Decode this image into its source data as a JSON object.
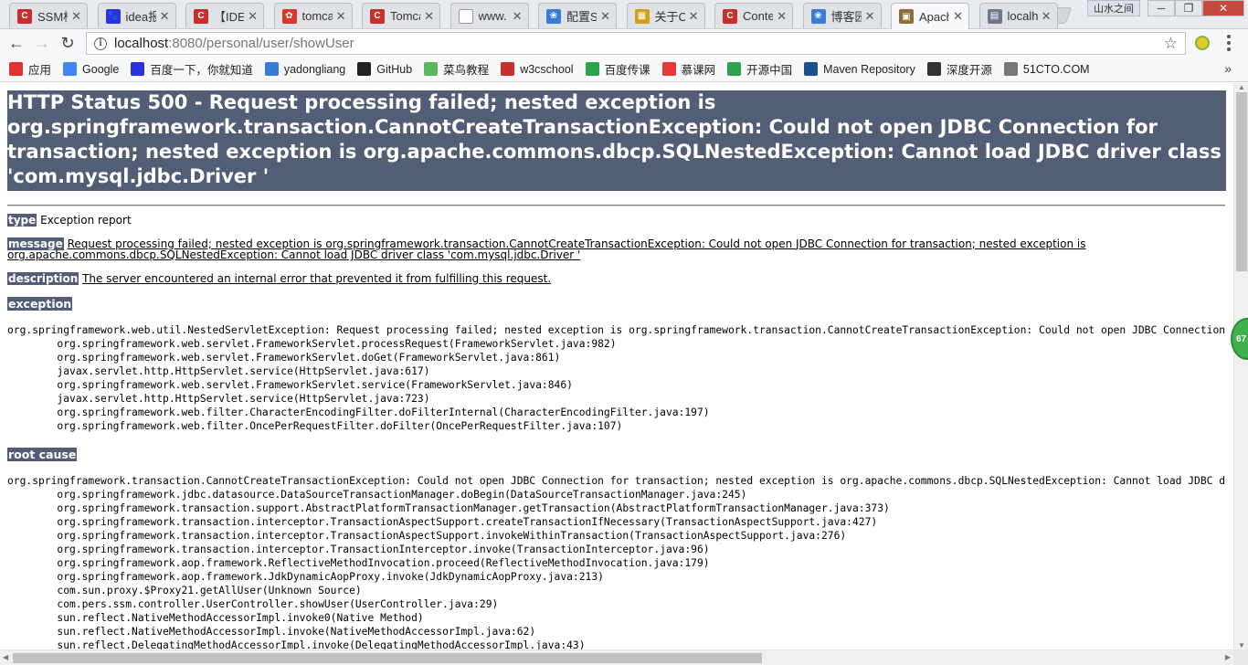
{
  "tabs": [
    {
      "label": "SSM框架",
      "icon": "C",
      "color": "#c7302a"
    },
    {
      "label": "idea报",
      "icon": "🐾",
      "color": "#2932e1"
    },
    {
      "label": "【IDEA",
      "icon": "C",
      "color": "#c7302a"
    },
    {
      "label": "tomcat",
      "icon": "✿",
      "color": "#d9372b"
    },
    {
      "label": "Tomcat",
      "icon": "C",
      "color": "#c7302a"
    },
    {
      "label": "www.",
      "icon": "",
      "color": "#ffffff"
    },
    {
      "label": "配置SSM",
      "icon": "❀",
      "color": "#3a7bd5"
    },
    {
      "label": "关于C",
      "icon": "▦",
      "color": "#d4a017"
    },
    {
      "label": "Contex",
      "icon": "C",
      "color": "#c7302a"
    },
    {
      "label": "博客园",
      "icon": "❀",
      "color": "#3a7bd5"
    },
    {
      "label": "Apache",
      "icon": "▣",
      "color": "#8b6d3a"
    },
    {
      "label": "localh",
      "icon": "▤",
      "color": "#6d7a8a"
    }
  ],
  "window": {
    "user_label": "山水之间",
    "minimize": "─",
    "maximize": "❐",
    "close": "✕"
  },
  "toolbar": {
    "back": "←",
    "forward": "→",
    "reload": "↻",
    "url_host": "localhost",
    "url_rest": ":8080/personal/user/showUser",
    "info": "i",
    "star": "☆"
  },
  "bookmarks": [
    {
      "label": "应用",
      "color": "#d33"
    },
    {
      "label": "Google",
      "color": "#4285f4"
    },
    {
      "label": "百度一下，你就知道",
      "color": "#2932e1"
    },
    {
      "label": "yadongliang",
      "color": "#3a7bd5"
    },
    {
      "label": "GitHub",
      "color": "#222222"
    },
    {
      "label": "菜鸟教程",
      "color": "#5cb85c"
    },
    {
      "label": "w3cschool",
      "color": "#c7302a"
    },
    {
      "label": "百度传课",
      "color": "#2ca24a"
    },
    {
      "label": "慕课网",
      "color": "#e53935"
    },
    {
      "label": "开源中国",
      "color": "#2ca24a"
    },
    {
      "label": "Maven Repository",
      "color": "#1c4f8c"
    },
    {
      "label": "深度开源",
      "color": "#333333"
    },
    {
      "label": "51CTO.COM",
      "color": "#777777"
    }
  ],
  "bookmarks_more": "»",
  "page": {
    "title": "HTTP Status 500 - Request processing failed; nested exception is org.springframework.transaction.CannotCreateTransactionException: Could not open JDBC Connection for transaction; nested exception is org.apache.commons.dbcp.SQLNestedException: Cannot load JDBC driver class 'com.mysql.jdbc.Driver '",
    "type_label": "type",
    "type_value": "Exception report",
    "message_label": "message",
    "message_value": "Request processing failed; nested exception is org.springframework.transaction.CannotCreateTransactionException: Could not open JDBC Connection for transaction; nested exception is org.apache.commons.dbcp.SQLNestedException: Cannot load JDBC driver class 'com.mysql.jdbc.Driver '",
    "description_label": "description",
    "description_value": "The server encountered an internal error that prevented it from fulfilling this request.",
    "exception_label": "exception",
    "exception_trace": "org.springframework.web.util.NestedServletException: Request processing failed; nested exception is org.springframework.transaction.CannotCreateTransactionException: Could not open JDBC Connection for transaction; nested exception is org.apache.commons.dbcp.SQLNestedException: Cannot load JDBC driver class 'com.mysql.jdbc.Driver '\n\torg.springframework.web.servlet.FrameworkServlet.processRequest(FrameworkServlet.java:982)\n\torg.springframework.web.servlet.FrameworkServlet.doGet(FrameworkServlet.java:861)\n\tjavax.servlet.http.HttpServlet.service(HttpServlet.java:617)\n\torg.springframework.web.servlet.FrameworkServlet.service(FrameworkServlet.java:846)\n\tjavax.servlet.http.HttpServlet.service(HttpServlet.java:723)\n\torg.springframework.web.filter.CharacterEncodingFilter.doFilterInternal(CharacterEncodingFilter.java:197)\n\torg.springframework.web.filter.OncePerRequestFilter.doFilter(OncePerRequestFilter.java:107)",
    "root_cause_label": "root cause",
    "root_cause_trace": "org.springframework.transaction.CannotCreateTransactionException: Could not open JDBC Connection for transaction; nested exception is org.apache.commons.dbcp.SQLNestedException: Cannot load JDBC driver class 'com.mysql.jdbc.Driver '\n\torg.springframework.jdbc.datasource.DataSourceTransactionManager.doBegin(DataSourceTransactionManager.java:245)\n\torg.springframework.transaction.support.AbstractPlatformTransactionManager.getTransaction(AbstractPlatformTransactionManager.java:373)\n\torg.springframework.transaction.interceptor.TransactionAspectSupport.createTransactionIfNecessary(TransactionAspectSupport.java:427)\n\torg.springframework.transaction.interceptor.TransactionAspectSupport.invokeWithinTransaction(TransactionAspectSupport.java:276)\n\torg.springframework.transaction.interceptor.TransactionInterceptor.invoke(TransactionInterceptor.java:96)\n\torg.springframework.aop.framework.ReflectiveMethodInvocation.proceed(ReflectiveMethodInvocation.java:179)\n\torg.springframework.aop.framework.JdkDynamicAopProxy.invoke(JdkDynamicAopProxy.java:213)\n\tcom.sun.proxy.$Proxy21.getAllUser(Unknown Source)\n\tcom.pers.ssm.controller.UserController.showUser(UserController.java:29)\n\tsun.reflect.NativeMethodAccessorImpl.invoke0(Native Method)\n\tsun.reflect.NativeMethodAccessorImpl.invoke(NativeMethodAccessorImpl.java:62)\n\tsun.reflect.DelegatingMethodAccessorImpl.invoke(DelegatingMethodAccessorImpl.java:43)"
  },
  "badge_text": "67",
  "colors": {
    "tomcat_header": "#525d76",
    "tab_strip": "#e8ebf0",
    "toolbar": "#f7f8f9"
  }
}
